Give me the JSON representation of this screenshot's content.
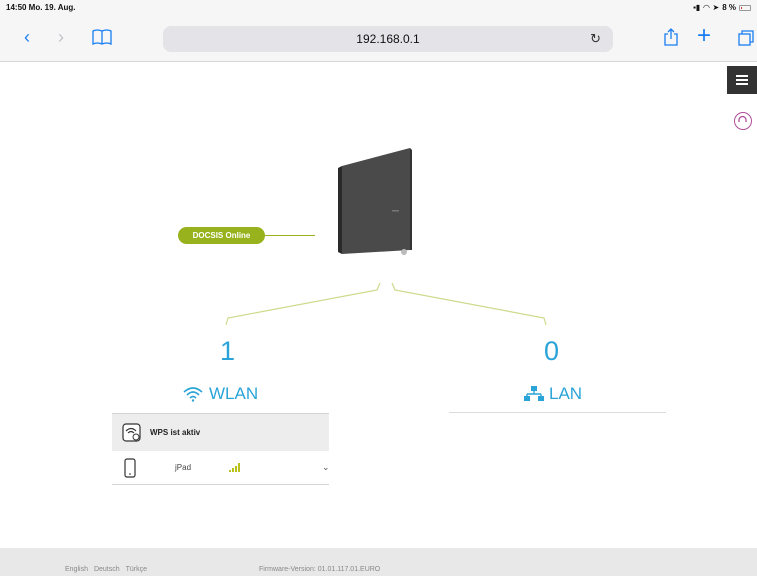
{
  "status_bar": {
    "time": "14:50  Mo. 19. Aug.",
    "battery": "8 %"
  },
  "browser": {
    "url": "192.168.0.1"
  },
  "router": {
    "status_badge": "DOCSIS Online"
  },
  "wlan": {
    "count": "1",
    "label": "WLAN",
    "wps_text": "WPS ist aktiv",
    "devices": [
      {
        "name": "jPad"
      }
    ]
  },
  "lan": {
    "count": "0",
    "label": "LAN"
  },
  "footer": {
    "languages": [
      "English",
      "Deutsch",
      "Türkçe"
    ],
    "firmware": "Firmware-Version: 01.01.117.01.EURO"
  },
  "colors": {
    "accent": "#2aa4d8",
    "docsis": "#97b21c",
    "signal": "#b8c21a",
    "ios_blue": "#1a7ef2"
  }
}
